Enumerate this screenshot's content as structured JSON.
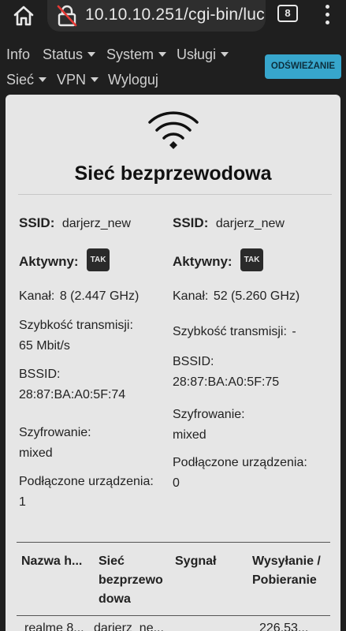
{
  "browser": {
    "url": "10.10.10.251/cgi-bin/luc",
    "tab_count": "8"
  },
  "nav": {
    "items": [
      {
        "label": "Info",
        "dropdown": false
      },
      {
        "label": "Status",
        "dropdown": true
      },
      {
        "label": "System",
        "dropdown": true
      },
      {
        "label": "Usługi",
        "dropdown": true
      },
      {
        "label": "Sieć",
        "dropdown": true
      },
      {
        "label": "VPN",
        "dropdown": true
      },
      {
        "label": "Wyloguj",
        "dropdown": false
      }
    ],
    "refresh_label": "ODŚWIEŻANIE"
  },
  "card": {
    "title": "Sieć bezprzewodowa",
    "radios": [
      {
        "ssid_label": "SSID",
        "ssid": "darjerz_new",
        "active_label": "Aktywny",
        "active": "TAK",
        "channel_label": "Kanał",
        "channel": "8 (2.447 GHz)",
        "rate_label": "Szybkość transmisji",
        "rate": "65 Mbit/s",
        "bssid_label": "BSSID",
        "bssid": "28:87:BA:A0:5F:74",
        "encryption_label": "Szyfrowanie",
        "encryption": "mixed",
        "clients_label": "Podłączone urządzenia",
        "clients": "1"
      },
      {
        "ssid_label": "SSID",
        "ssid": "darjerz_new",
        "active_label": "Aktywny",
        "active": "TAK",
        "channel_label": "Kanał",
        "channel": "52 (5.260 GHz)",
        "rate_label": "Szybkość transmisji",
        "rate": "-",
        "bssid_label": "BSSID",
        "bssid": "28:87:BA:A0:5F:75",
        "encryption_label": "Szyfrowanie",
        "encryption": "mixed",
        "clients_label": "Podłączone urządzenia",
        "clients": "0"
      }
    ]
  },
  "table": {
    "headers": [
      "Nazwa h...",
      "Sieć bezprzewo dowa",
      "Sygnał",
      "Wysyłanie / Pobieranie"
    ],
    "rows": [
      [
        "realme 8...",
        "darjerz_ne...",
        "",
        "226.53..."
      ]
    ]
  }
}
